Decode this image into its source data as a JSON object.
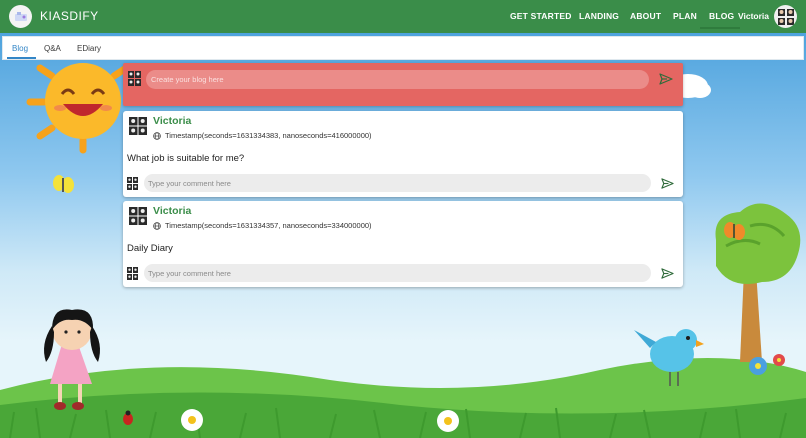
{
  "navbar": {
    "brand": "KIASDIFY",
    "links": [
      {
        "label": "GET STARTED"
      },
      {
        "label": "LANDING"
      },
      {
        "label": "ABOUT"
      },
      {
        "label": "PLAN"
      },
      {
        "label": "BLOG"
      }
    ],
    "user_name": "Victoria"
  },
  "tabs": [
    {
      "label": "Blog"
    },
    {
      "label": "Q&A"
    },
    {
      "label": "EDiary"
    }
  ],
  "create_post": {
    "placeholder": "Create your blog here"
  },
  "posts": [
    {
      "author": "Victoria",
      "timestamp": "Timestamp(seconds=1631334383, nanoseconds=416000000)",
      "content": "What job is suitable for me?",
      "comment_placeholder": "Type your comment here"
    },
    {
      "author": "Victoria",
      "timestamp": "Timestamp(seconds=1631334357, nanoseconds=334000000)",
      "content": "Daily Diary",
      "comment_placeholder": "Type your comment here"
    }
  ],
  "colors": {
    "navbar": "#3a8d49",
    "create_bar": "#e46662",
    "author": "#3a8d49",
    "active_tab": "#3386c7"
  }
}
